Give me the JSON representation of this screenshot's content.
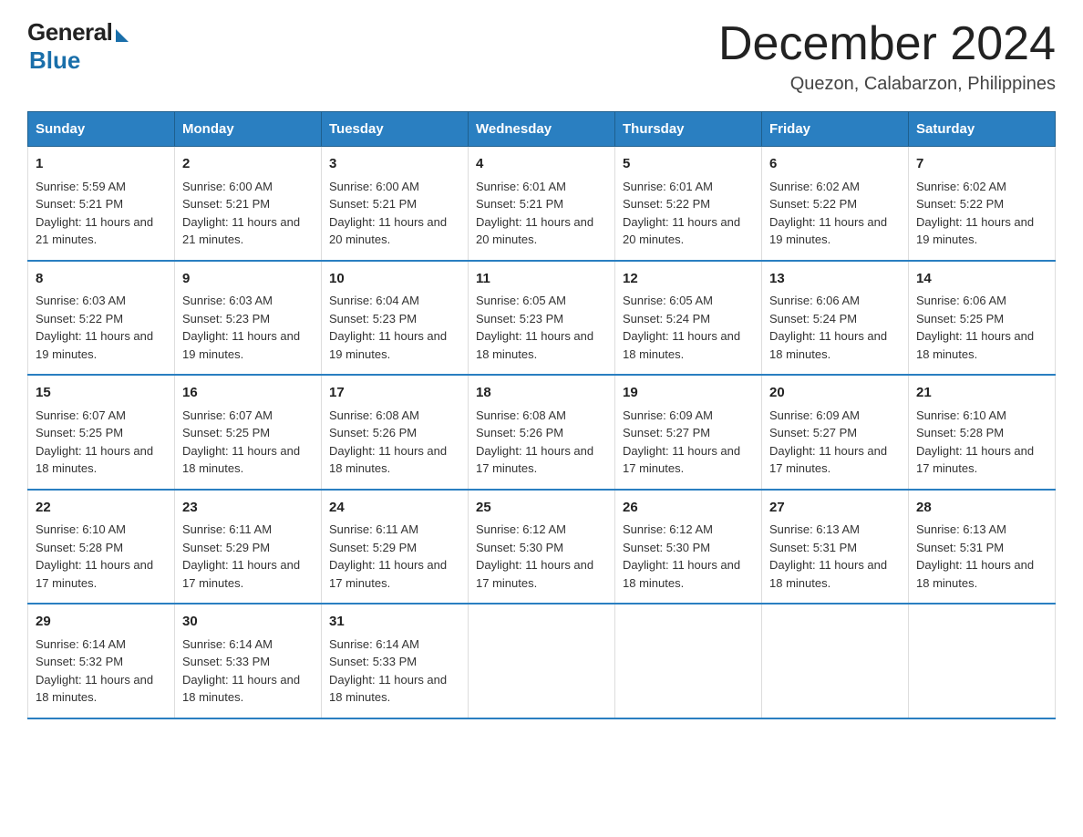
{
  "logo": {
    "general": "General",
    "blue": "Blue"
  },
  "title": "December 2024",
  "location": "Quezon, Calabarzon, Philippines",
  "days_of_week": [
    "Sunday",
    "Monday",
    "Tuesday",
    "Wednesday",
    "Thursday",
    "Friday",
    "Saturday"
  ],
  "weeks": [
    [
      {
        "day": "1",
        "sunrise": "5:59 AM",
        "sunset": "5:21 PM",
        "daylight": "11 hours and 21 minutes."
      },
      {
        "day": "2",
        "sunrise": "6:00 AM",
        "sunset": "5:21 PM",
        "daylight": "11 hours and 21 minutes."
      },
      {
        "day": "3",
        "sunrise": "6:00 AM",
        "sunset": "5:21 PM",
        "daylight": "11 hours and 20 minutes."
      },
      {
        "day": "4",
        "sunrise": "6:01 AM",
        "sunset": "5:21 PM",
        "daylight": "11 hours and 20 minutes."
      },
      {
        "day": "5",
        "sunrise": "6:01 AM",
        "sunset": "5:22 PM",
        "daylight": "11 hours and 20 minutes."
      },
      {
        "day": "6",
        "sunrise": "6:02 AM",
        "sunset": "5:22 PM",
        "daylight": "11 hours and 19 minutes."
      },
      {
        "day": "7",
        "sunrise": "6:02 AM",
        "sunset": "5:22 PM",
        "daylight": "11 hours and 19 minutes."
      }
    ],
    [
      {
        "day": "8",
        "sunrise": "6:03 AM",
        "sunset": "5:22 PM",
        "daylight": "11 hours and 19 minutes."
      },
      {
        "day": "9",
        "sunrise": "6:03 AM",
        "sunset": "5:23 PM",
        "daylight": "11 hours and 19 minutes."
      },
      {
        "day": "10",
        "sunrise": "6:04 AM",
        "sunset": "5:23 PM",
        "daylight": "11 hours and 19 minutes."
      },
      {
        "day": "11",
        "sunrise": "6:05 AM",
        "sunset": "5:23 PM",
        "daylight": "11 hours and 18 minutes."
      },
      {
        "day": "12",
        "sunrise": "6:05 AM",
        "sunset": "5:24 PM",
        "daylight": "11 hours and 18 minutes."
      },
      {
        "day": "13",
        "sunrise": "6:06 AM",
        "sunset": "5:24 PM",
        "daylight": "11 hours and 18 minutes."
      },
      {
        "day": "14",
        "sunrise": "6:06 AM",
        "sunset": "5:25 PM",
        "daylight": "11 hours and 18 minutes."
      }
    ],
    [
      {
        "day": "15",
        "sunrise": "6:07 AM",
        "sunset": "5:25 PM",
        "daylight": "11 hours and 18 minutes."
      },
      {
        "day": "16",
        "sunrise": "6:07 AM",
        "sunset": "5:25 PM",
        "daylight": "11 hours and 18 minutes."
      },
      {
        "day": "17",
        "sunrise": "6:08 AM",
        "sunset": "5:26 PM",
        "daylight": "11 hours and 18 minutes."
      },
      {
        "day": "18",
        "sunrise": "6:08 AM",
        "sunset": "5:26 PM",
        "daylight": "11 hours and 17 minutes."
      },
      {
        "day": "19",
        "sunrise": "6:09 AM",
        "sunset": "5:27 PM",
        "daylight": "11 hours and 17 minutes."
      },
      {
        "day": "20",
        "sunrise": "6:09 AM",
        "sunset": "5:27 PM",
        "daylight": "11 hours and 17 minutes."
      },
      {
        "day": "21",
        "sunrise": "6:10 AM",
        "sunset": "5:28 PM",
        "daylight": "11 hours and 17 minutes."
      }
    ],
    [
      {
        "day": "22",
        "sunrise": "6:10 AM",
        "sunset": "5:28 PM",
        "daylight": "11 hours and 17 minutes."
      },
      {
        "day": "23",
        "sunrise": "6:11 AM",
        "sunset": "5:29 PM",
        "daylight": "11 hours and 17 minutes."
      },
      {
        "day": "24",
        "sunrise": "6:11 AM",
        "sunset": "5:29 PM",
        "daylight": "11 hours and 17 minutes."
      },
      {
        "day": "25",
        "sunrise": "6:12 AM",
        "sunset": "5:30 PM",
        "daylight": "11 hours and 17 minutes."
      },
      {
        "day": "26",
        "sunrise": "6:12 AM",
        "sunset": "5:30 PM",
        "daylight": "11 hours and 18 minutes."
      },
      {
        "day": "27",
        "sunrise": "6:13 AM",
        "sunset": "5:31 PM",
        "daylight": "11 hours and 18 minutes."
      },
      {
        "day": "28",
        "sunrise": "6:13 AM",
        "sunset": "5:31 PM",
        "daylight": "11 hours and 18 minutes."
      }
    ],
    [
      {
        "day": "29",
        "sunrise": "6:14 AM",
        "sunset": "5:32 PM",
        "daylight": "11 hours and 18 minutes."
      },
      {
        "day": "30",
        "sunrise": "6:14 AM",
        "sunset": "5:33 PM",
        "daylight": "11 hours and 18 minutes."
      },
      {
        "day": "31",
        "sunrise": "6:14 AM",
        "sunset": "5:33 PM",
        "daylight": "11 hours and 18 minutes."
      },
      null,
      null,
      null,
      null
    ]
  ]
}
